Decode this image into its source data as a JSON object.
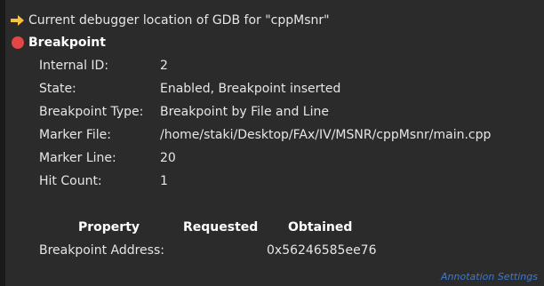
{
  "header": {
    "location_text": "Current debugger location of GDB for \"cppMsnr\""
  },
  "breakpoint": {
    "title": "Breakpoint",
    "properties": [
      {
        "label": "Internal ID:",
        "value": "2"
      },
      {
        "label": "State:",
        "value": "Enabled, Breakpoint inserted"
      },
      {
        "label": "Breakpoint Type:",
        "value": "Breakpoint by File and Line"
      },
      {
        "label": "Marker File:",
        "value": "/home/staki/Desktop/FAx/IV/MSNR/cppMsnr/main.cpp"
      },
      {
        "label": "Marker Line:",
        "value": "20"
      },
      {
        "label": "Hit Count:",
        "value": "1"
      }
    ]
  },
  "table": {
    "headers": [
      "Property",
      "Requested",
      "Obtained"
    ],
    "rows": [
      {
        "property": "Breakpoint Address:",
        "requested": "",
        "obtained": "0x56246585ee76"
      }
    ]
  },
  "footer": {
    "link_label": "Annotation Settings"
  },
  "colors": {
    "background": "#2b2b2b",
    "text": "#e6e6e6",
    "arrow": "#f5c242",
    "breakpoint": "#e64545",
    "link": "#3a7bd5"
  },
  "icons": {
    "location": "arrow-right-icon",
    "breakpoint": "breakpoint-icon"
  }
}
